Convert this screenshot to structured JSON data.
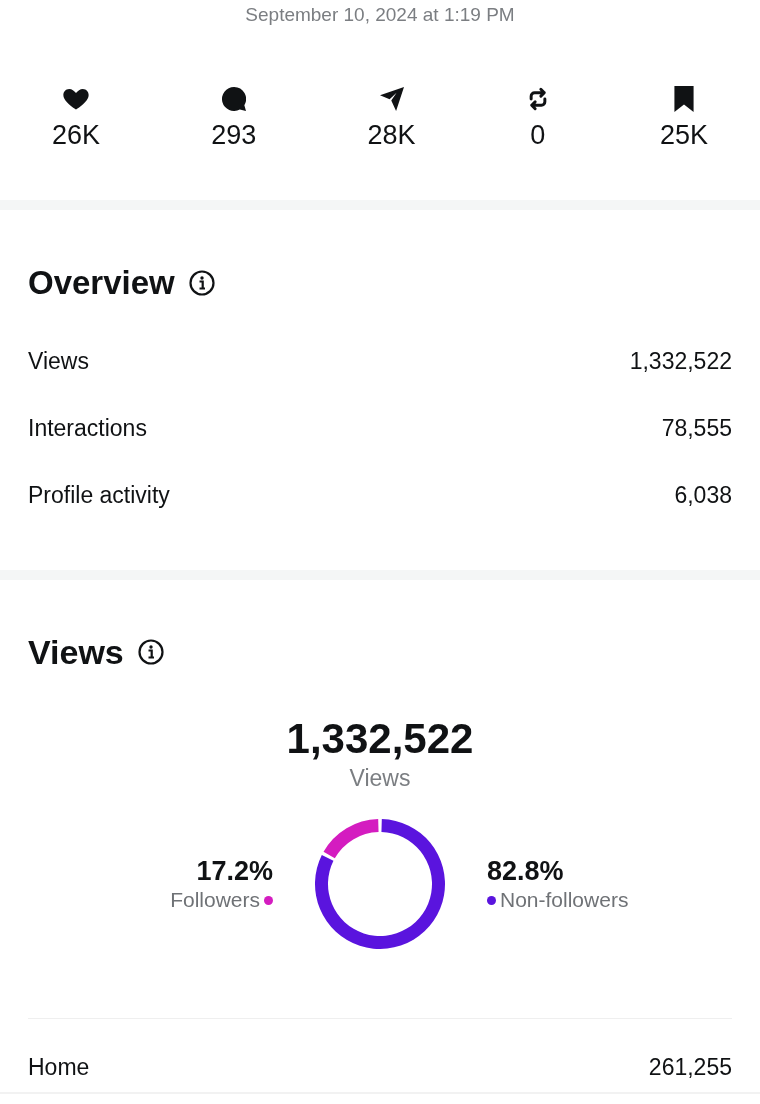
{
  "timestamp": "September 10, 2024 at 1:19 PM",
  "engagement": [
    {
      "kind": "like",
      "count": "26K"
    },
    {
      "kind": "comment",
      "count": "293"
    },
    {
      "kind": "share",
      "count": "28K"
    },
    {
      "kind": "repost",
      "count": "0"
    },
    {
      "kind": "save",
      "count": "25K"
    }
  ],
  "overview": {
    "title": "Overview",
    "rows": [
      {
        "label": "Views",
        "value": "1,332,522"
      },
      {
        "label": "Interactions",
        "value": "78,555"
      },
      {
        "label": "Profile activity",
        "value": "6,038"
      }
    ]
  },
  "views": {
    "title": "Views",
    "total": "1,332,522",
    "total_label": "Views",
    "chart_data": {
      "type": "donut",
      "categories": [
        "Followers",
        "Non-followers"
      ],
      "values": [
        17.2,
        82.8
      ]
    },
    "legend": [
      {
        "percent": "17.2%",
        "color": "#d41cc0"
      },
      {
        "percent": "82.8%",
        "color": "#5a14de"
      }
    ],
    "sources": [
      {
        "label": "Home",
        "value": "261,255"
      }
    ]
  }
}
